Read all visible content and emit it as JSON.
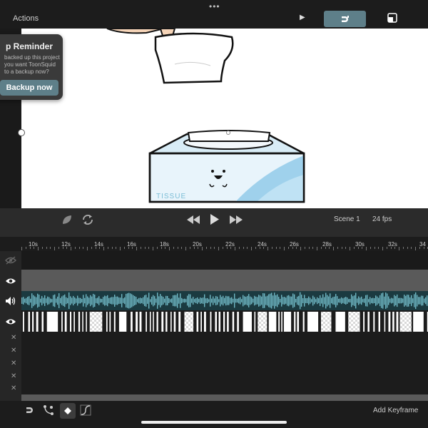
{
  "header": {
    "actions_label": "Actions",
    "more_icon": "ellipsis-icon",
    "icons": [
      "play-icon",
      "magnet-icon",
      "layers-icon"
    ],
    "accent_color": "#5e7f89"
  },
  "popup": {
    "title": "p Reminder",
    "body": "backed up this project you want ToonSquid to a backup now?",
    "button_label": "Backup now"
  },
  "canvas": {
    "box_text": "TISSUE"
  },
  "transport": {
    "scene_label": "Scene 1",
    "fps_label": "24 fps",
    "icons": [
      "onion-skin-icon",
      "loop-icon",
      "rewind-icon",
      "play-icon",
      "fast-forward-icon"
    ]
  },
  "ruler": {
    "labels": [
      "10s",
      "12s",
      "14s",
      "16s",
      "18s",
      "20s",
      "22s",
      "24s",
      "26s",
      "28s",
      "30s",
      "32s",
      "34"
    ]
  },
  "tracks": {
    "icons": [
      "hidden-eye-icon",
      "eye-icon",
      "speaker-icon",
      "eye-icon",
      "x-icon",
      "x-icon",
      "x-icon",
      "x-icon",
      "x-icon"
    ],
    "audio_color": "#6fb7c4"
  },
  "bottombar": {
    "add_keyframe_label": "Add Keyframe",
    "icons": [
      "magnet-icon",
      "motion-path-icon",
      "keyframe-icon",
      "easing-curve-icon"
    ]
  }
}
